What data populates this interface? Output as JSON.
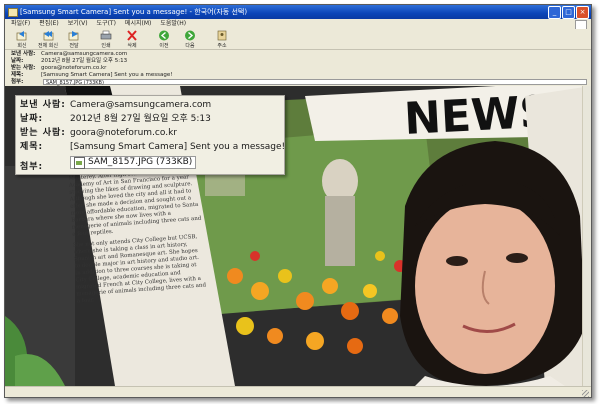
{
  "window": {
    "title": "[Samsung Smart Camera] Sent you a message!  - 한국어(자동 선택)"
  },
  "menu": {
    "items": [
      "파일(F)",
      "편집(E)",
      "보기(V)",
      "도구(T)",
      "메시지(M)",
      "도움말(H)"
    ]
  },
  "toolbar": {
    "buttons": [
      {
        "label": "회신",
        "icon": "reply-icon"
      },
      {
        "label": "전체 회신",
        "icon": "reply-all-icon"
      },
      {
        "label": "전달",
        "icon": "forward-icon"
      },
      {
        "label": "인쇄",
        "icon": "print-icon"
      },
      {
        "label": "삭제",
        "icon": "delete-icon"
      },
      {
        "label": "이전",
        "icon": "previous-icon"
      },
      {
        "label": "다음",
        "icon": "next-icon"
      },
      {
        "label": "주소",
        "icon": "address-book-icon"
      }
    ]
  },
  "header": {
    "from_label": "보낸 사람:",
    "from_value": "Camera@samsungcamera.com",
    "date_label": "날짜:",
    "date_value": "2012년 8월 27일 월요일 오후 5:13",
    "to_label": "받는 사람:",
    "to_value": "goora@noteforum.co.kr",
    "subject_label": "제목:",
    "subject_value": "[Samsung Smart Camera] Sent you a message!",
    "attach_label": "첨부:",
    "attach_value": "SAM_8157.JPG (733KB)"
  },
  "zoom": {
    "from_label": "보낸 사람:",
    "from_value": "Camera@samsungcamera.com",
    "date_label": "날짜:",
    "date_value": "2012년 8월 27일 월요일 오후 5:13",
    "to_label": "받는 사람:",
    "to_value": "goora@noteforum.co.kr",
    "subject_label": "제목:",
    "subject_value": "[Samsung Smart Camera] Sent you a message!",
    "attach_label": "첨부:",
    "attach_value": "SAM_8157.JPG (733KB)"
  },
  "photo": {
    "headline": "NEWS",
    "headline_left": "BI",
    "column_text": "Monterey. After high school, she attended the Academy of Art in San Francisco for a year studying the likes of drawing and sculpture. Although she loved the city and all it had to offer, she made a decision and sought out a more affordable education, migrated to Santa Barbara where she now lives with a menagerie of animals including three cats and a four reptiles.",
    "column_text_2": "She not only attends City College but UCSB, where she is taking a class in art history, Spanish art and Romanesque art. She hopes to double major in art history and studio art. In addition to three courses she is taking at City College, academic education and migrated French at City College, lives with a menagerie of animals including three cats and a four."
  }
}
